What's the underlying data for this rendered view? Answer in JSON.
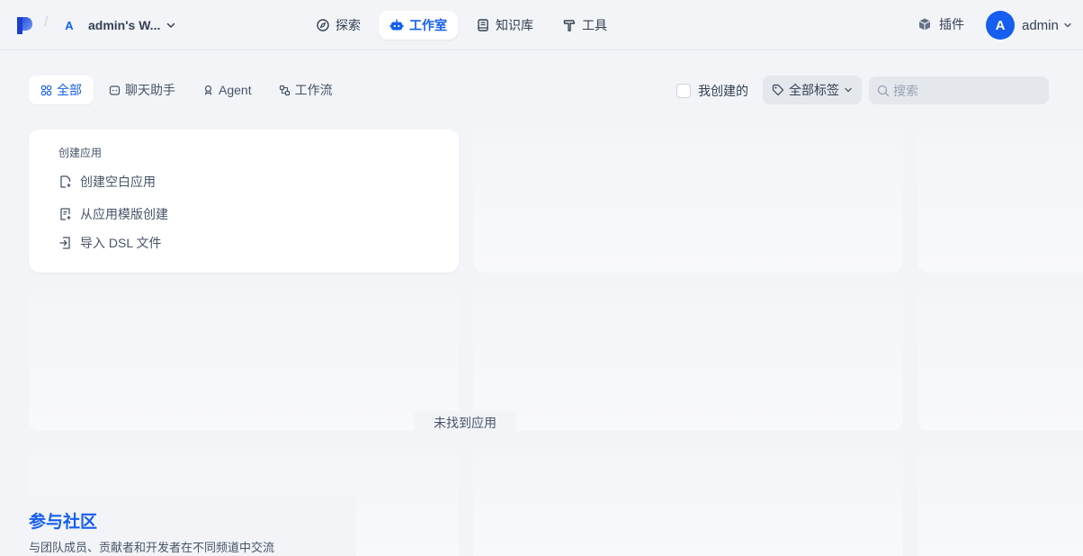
{
  "header": {
    "breadcrumb_sep": "/",
    "workspace": {
      "avatar_letter": "A",
      "name": "admin's W..."
    },
    "nav": [
      {
        "label": "探索",
        "icon": "compass-icon"
      },
      {
        "label": "工作室",
        "icon": "robot-icon",
        "active": true
      },
      {
        "label": "知识库",
        "icon": "book-icon"
      },
      {
        "label": "工具",
        "icon": "hammer-icon"
      }
    ],
    "plugins_label": "插件",
    "user": {
      "avatar_letter": "A",
      "name": "admin"
    }
  },
  "filters": {
    "tabs": [
      {
        "label": "全部",
        "icon": "grid-icon",
        "active": true
      },
      {
        "label": "聊天助手",
        "icon": "chat-icon"
      },
      {
        "label": "Agent",
        "icon": "agent-icon"
      },
      {
        "label": "工作流",
        "icon": "workflow-icon"
      }
    ],
    "mine_label": "我创建的",
    "tags_label": "全部标签",
    "search_placeholder": "搜索"
  },
  "create_card": {
    "title": "创建应用",
    "items": [
      {
        "label": "创建空白应用",
        "icon": "file-plus-icon"
      },
      {
        "label": "从应用模版创建",
        "icon": "template-icon"
      },
      {
        "label": "导入 DSL 文件",
        "icon": "import-icon"
      }
    ]
  },
  "empty_text": "未找到应用",
  "community": {
    "title": "参与社区",
    "description": "与团队成员、贡献者和开发者在不同频道中交流"
  },
  "colors": {
    "accent": "#155eef",
    "background": "#f2f4f7"
  }
}
